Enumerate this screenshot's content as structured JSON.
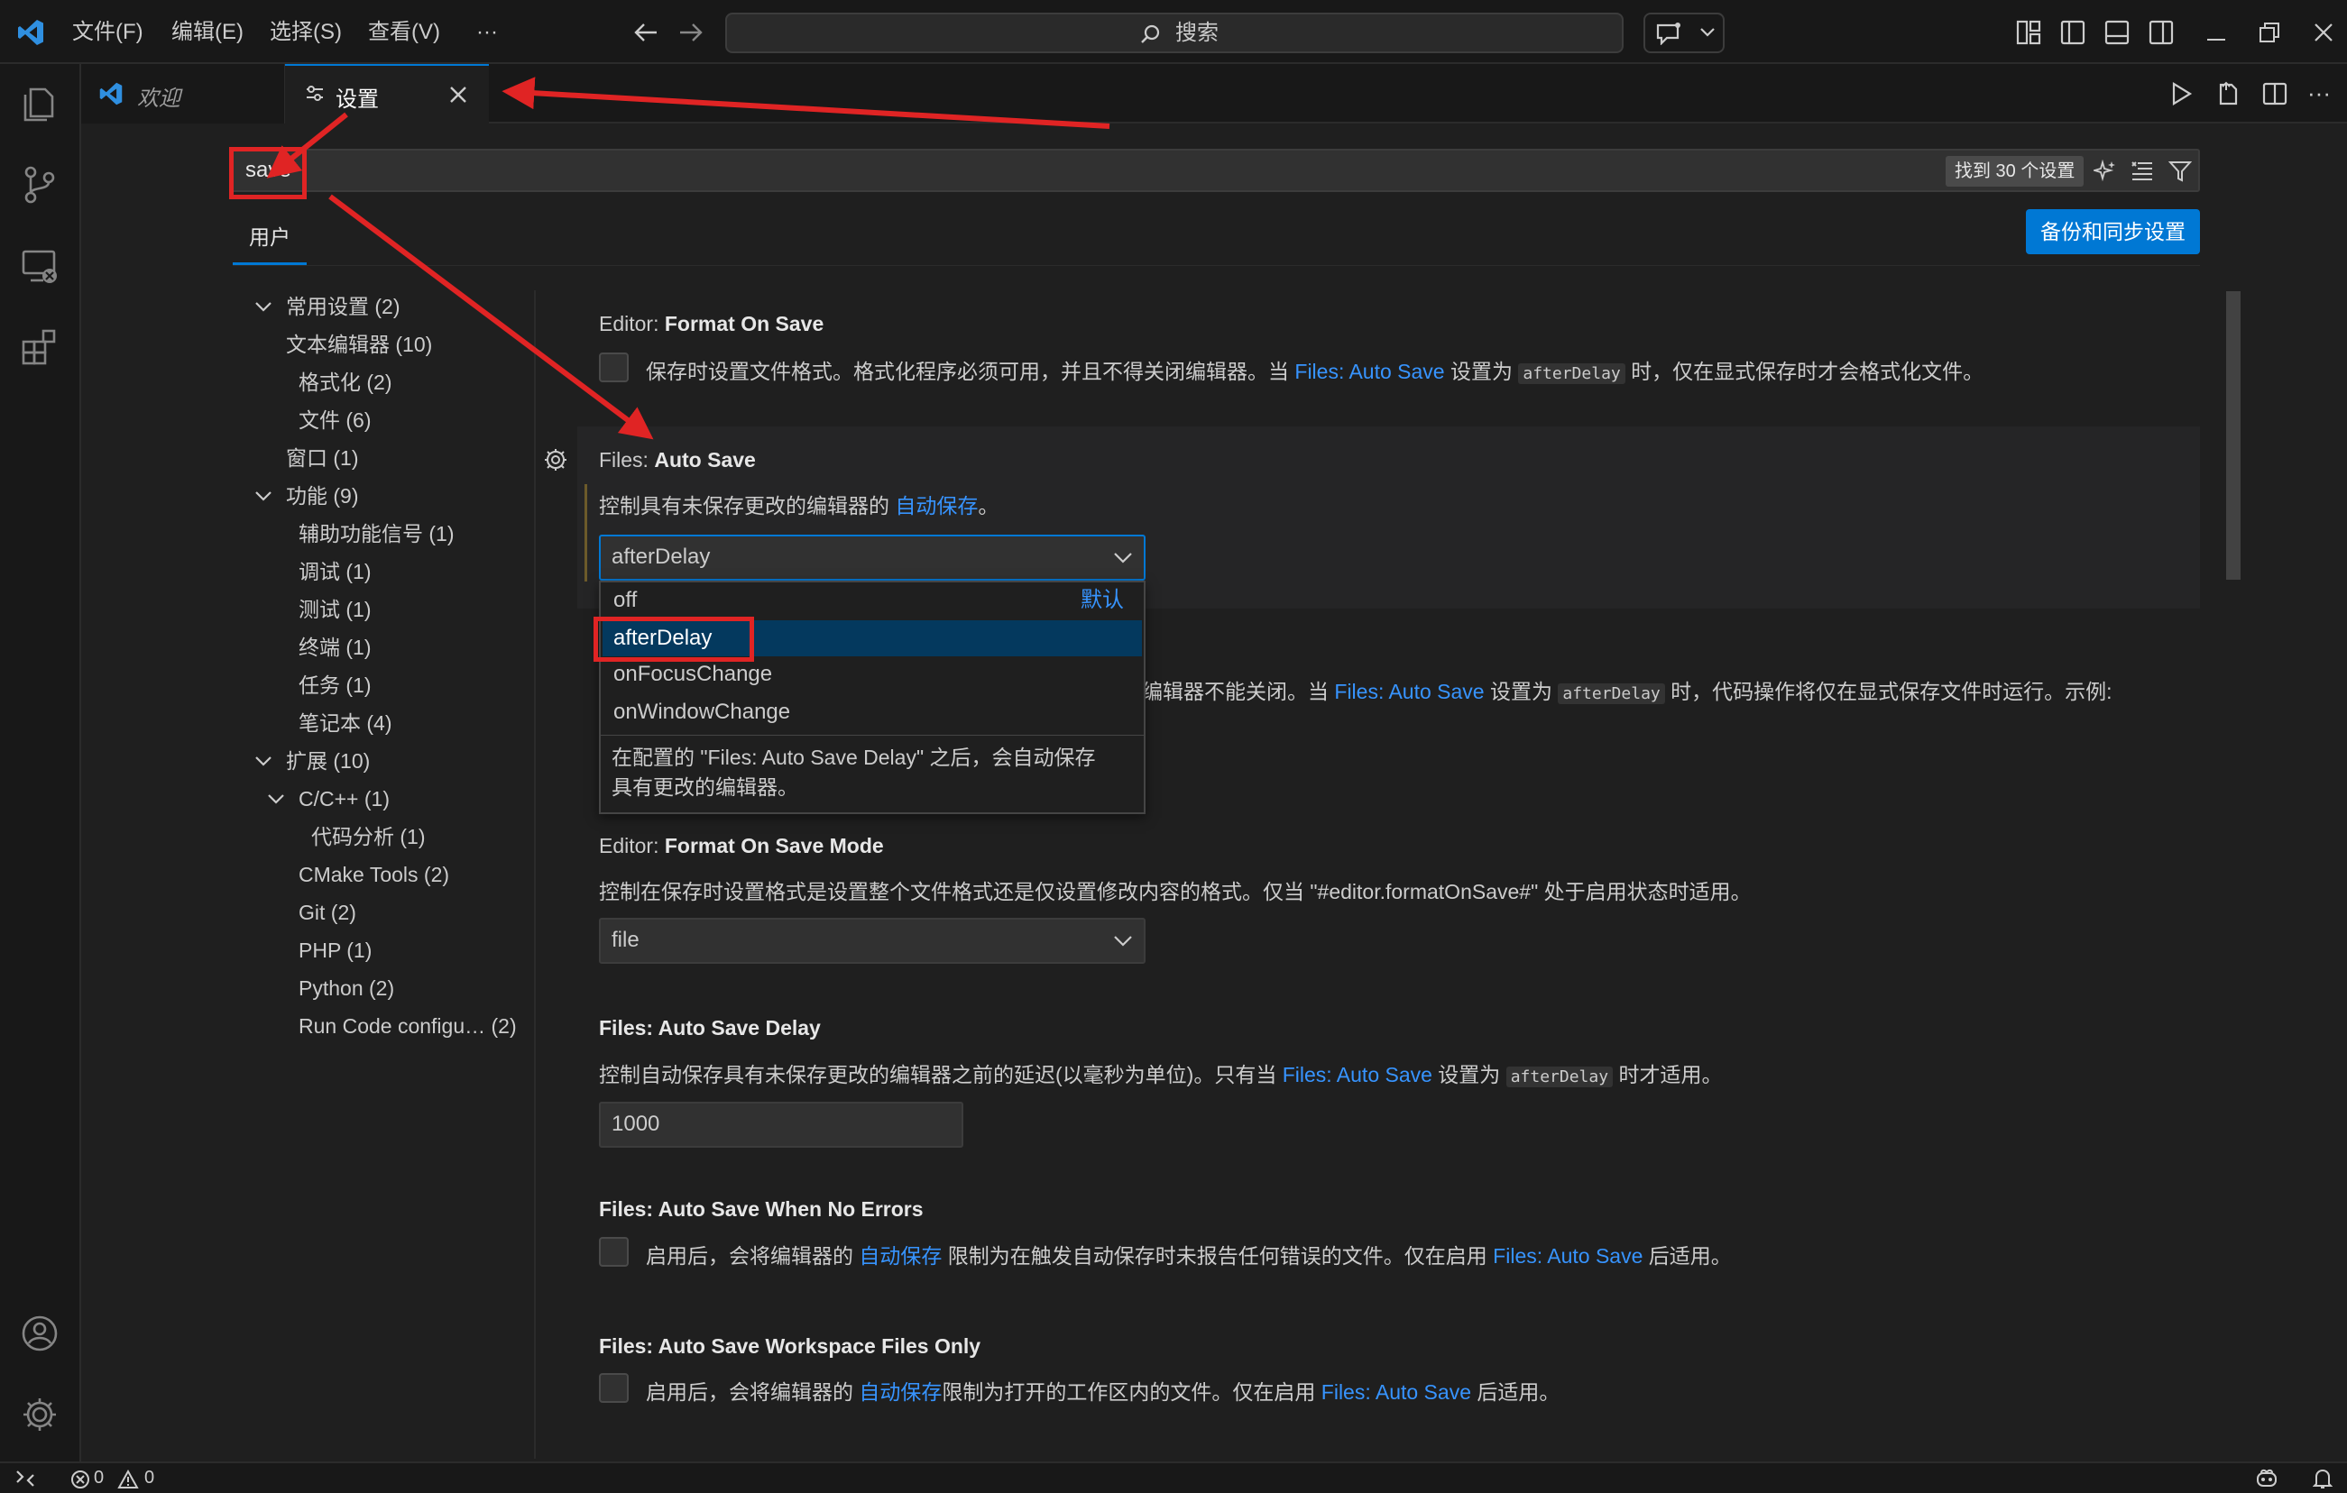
{
  "menu": {
    "file": "文件(F)",
    "edit": "编辑(E)",
    "selection": "选择(S)",
    "view": "查看(V)",
    "more": "···"
  },
  "command_center": {
    "label": "搜索"
  },
  "tabs": [
    {
      "label": "欢迎"
    },
    {
      "label": "设置"
    }
  ],
  "settings_search": {
    "value": "save",
    "result_count": "找到 30 个设置"
  },
  "scope_tab": "用户",
  "backup_button": "备份和同步设置",
  "toc": [
    {
      "label": "常用设置 (2)"
    },
    {
      "label": "文本编辑器 (10)"
    },
    {
      "label": "格式化 (2)"
    },
    {
      "label": "文件 (6)"
    },
    {
      "label": "窗口 (1)"
    },
    {
      "label": "功能 (9)"
    },
    {
      "label": "辅助功能信号 (1)"
    },
    {
      "label": "调试 (1)"
    },
    {
      "label": "测试 (1)"
    },
    {
      "label": "终端 (1)"
    },
    {
      "label": "任务 (1)"
    },
    {
      "label": "笔记本 (4)"
    },
    {
      "label": "扩展 (10)"
    },
    {
      "label": "C/C++ (1)"
    },
    {
      "label": "代码分析 (1)"
    },
    {
      "label": "CMake Tools (2)"
    },
    {
      "label": "Git (2)"
    },
    {
      "label": "PHP (1)"
    },
    {
      "label": "Python (2)"
    },
    {
      "label": "Run Code configu… (2)"
    }
  ],
  "settings": {
    "format_on_save": {
      "category": "Editor: ",
      "name": "Format On Save",
      "desc_a": "保存时设置文件格式。格式化程序必须可用，并且不得关闭编辑器。当 ",
      "link": "Files: Auto Save",
      "desc_b": " 设置为 ",
      "code": "afterDelay",
      "desc_c": " 时，仅在显式保存时才会格式化文件。"
    },
    "auto_save": {
      "category": "Files: ",
      "name": "Auto Save",
      "desc_a": "控制具有未保存更改的编辑器的 ",
      "link": "自动保存",
      "desc_b": "。",
      "value": "afterDelay"
    },
    "code_actions_on_save": {
      "desc_a": "编辑器不能关闭。当 ",
      "link": "Files: Auto Save",
      "desc_b": " 设置为 ",
      "code": "afterDelay",
      "desc_c": " 时，代码操作将仅在显式保存文件时运行。示例:"
    },
    "format_on_save_mode": {
      "category": "Editor: ",
      "name": "Format On Save Mode",
      "desc": "控制在保存时设置格式是设置整个文件格式还是仅设置修改内容的格式。仅当 \"#editor.formatOnSave#\" 处于启用状态时适用。",
      "value": "file"
    },
    "auto_save_delay": {
      "title": "Files: Auto Save Delay",
      "desc_a": "控制自动保存具有未保存更改的编辑器之前的延迟(以毫秒为单位)。只有当 ",
      "link": "Files: Auto Save",
      "desc_b": " 设置为 ",
      "code": "afterDelay",
      "desc_c": " 时才适用。",
      "value": "1000"
    },
    "auto_save_no_errors": {
      "title": "Files: Auto Save When No Errors",
      "desc_a": "启用后，会将编辑器的 ",
      "link": "自动保存",
      "desc_b": " 限制为在触发自动保存时未报告任何错误的文件。仅在启用 ",
      "link2": "Files: Auto Save",
      "desc_c": " 后适用。"
    },
    "auto_save_workspace": {
      "title": "Files: Auto Save Workspace Files Only",
      "desc_a": "启用后，会将编辑器的 ",
      "link": "自动保存",
      "desc_b": "限制为打开的工作区内的文件。仅在启用 ",
      "link2": "Files: Auto Save",
      "desc_c": " 后适用。"
    }
  },
  "dropdown": {
    "options": [
      {
        "label": "off",
        "tag": "默认"
      },
      {
        "label": "afterDelay"
      },
      {
        "label": "onFocusChange"
      },
      {
        "label": "onWindowChange"
      }
    ],
    "description": [
      "在配置的 \"Files: Auto Save Delay\" 之后，会自动保存",
      "具有更改的编辑器。"
    ]
  },
  "statusbar": {
    "errors": "0",
    "warnings": "0"
  },
  "colors": {
    "accent": "#0078d4",
    "link": "#3794ff",
    "annotation": "#e02424",
    "selected_option": "#04395e"
  }
}
